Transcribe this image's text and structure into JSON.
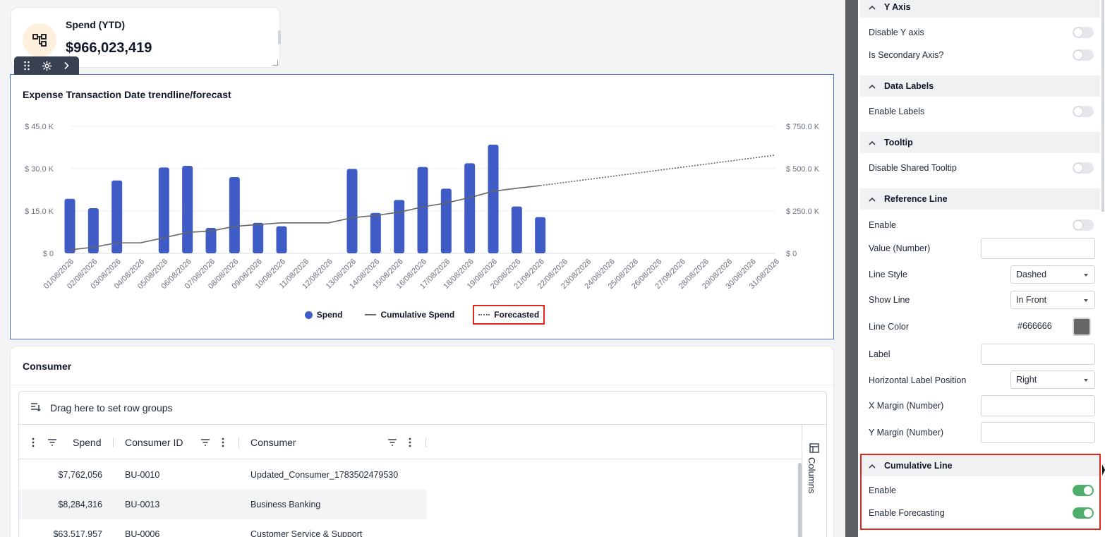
{
  "kpi": {
    "title": "Spend (YTD)",
    "value": "$966,023,419"
  },
  "chart_data": {
    "type": "bar",
    "title": "Expense Transaction Date trendline/forecast",
    "categories": [
      "01/08/2026",
      "02/08/2026",
      "03/08/2026",
      "04/08/2026",
      "05/08/2026",
      "06/08/2026",
      "07/08/2026",
      "08/08/2026",
      "09/08/2026",
      "10/08/2026",
      "11/08/2026",
      "12/08/2026",
      "13/08/2026",
      "14/08/2026",
      "15/08/2026",
      "16/08/2026",
      "17/08/2026",
      "18/08/2026",
      "19/08/2026",
      "20/08/2026",
      "21/08/2026",
      "22/08/2026",
      "23/08/2026",
      "24/08/2026",
      "25/08/2026",
      "26/08/2026",
      "27/08/2026",
      "28/08/2026",
      "29/08/2026",
      "30/08/2026",
      "31/08/2026"
    ],
    "y_ticks": [
      "$ 0",
      "$ 15.0 K",
      "$ 30.0 K",
      "$ 45.0 K"
    ],
    "y2_ticks": [
      "$ 0",
      "$ 250.0 K",
      "$ 500.0 K",
      "$ 750.0 K"
    ],
    "ylim": [
      0,
      45000
    ],
    "y2lim": [
      0,
      750000
    ],
    "series": [
      {
        "name": "Spend",
        "axis": "left",
        "values": [
          19300,
          16000,
          25800,
          null,
          30400,
          31000,
          9000,
          27000,
          10800,
          9600,
          null,
          null,
          29900,
          14300,
          18900,
          30600,
          22900,
          31900,
          38500,
          16600,
          12800,
          null,
          null,
          null,
          null,
          null,
          null,
          null,
          null,
          null,
          null
        ]
      },
      {
        "name": "Cumulative Spend",
        "axis": "right",
        "values": [
          20000,
          36000,
          62000,
          62000,
          92000,
          123000,
          132000,
          159000,
          170000,
          180000,
          180000,
          180000,
          210000,
          224000,
          243000,
          274000,
          297000,
          329000,
          367000,
          384000,
          400000,
          null,
          null,
          null,
          null,
          null,
          null,
          null,
          null,
          null,
          null
        ]
      },
      {
        "name": "Forecasted",
        "axis": "right",
        "values": [
          null,
          null,
          null,
          null,
          null,
          null,
          null,
          null,
          null,
          null,
          null,
          null,
          null,
          null,
          null,
          null,
          null,
          null,
          null,
          null,
          400000,
          418000,
          436000,
          454000,
          472000,
          490000,
          508000,
          526000,
          544000,
          562000,
          580000
        ]
      }
    ],
    "legend_position": "bottom",
    "colors": {
      "spend": "#3e5bc6",
      "cumulative": "#666666",
      "forecast": "#666666"
    },
    "grid": true
  },
  "consumer": {
    "title": "Consumer",
    "group_hint": "Drag here to set row groups",
    "columns": [
      "Spend",
      "Consumer ID",
      "Consumer"
    ],
    "side_label": "Columns",
    "rows": [
      {
        "spend": "$7,762,056",
        "id": "BU-0010",
        "name": "Updated_Consumer_1783502479530"
      },
      {
        "spend": "$8,284,316",
        "id": "BU-0013",
        "name": "Business Banking"
      },
      {
        "spend": "$63,517,957",
        "id": "BU-0006",
        "name": "Customer Service & Support"
      }
    ]
  },
  "panel": {
    "y_axis": {
      "title": "Y Axis",
      "disable": "Disable Y axis",
      "secondary": "Is Secondary Axis?"
    },
    "data_labels": {
      "title": "Data Labels",
      "enable": "Enable Labels"
    },
    "tooltip": {
      "title": "Tooltip",
      "disable_shared": "Disable Shared Tooltip"
    },
    "reference_line": {
      "title": "Reference Line",
      "enable": "Enable",
      "value": "Value (Number)",
      "line_style": "Line Style",
      "line_style_value": "Dashed",
      "show_line": "Show Line",
      "show_line_value": "In Front",
      "line_color": "Line Color",
      "line_color_value": "#666666",
      "label": "Label",
      "h_label_pos": "Horizontal Label Position",
      "h_label_pos_value": "Right",
      "x_margin": "X Margin (Number)",
      "y_margin": "Y Margin (Number)"
    },
    "cumulative_line": {
      "title": "Cumulative Line",
      "enable": "Enable",
      "enable_forecasting": "Enable Forecasting"
    }
  }
}
